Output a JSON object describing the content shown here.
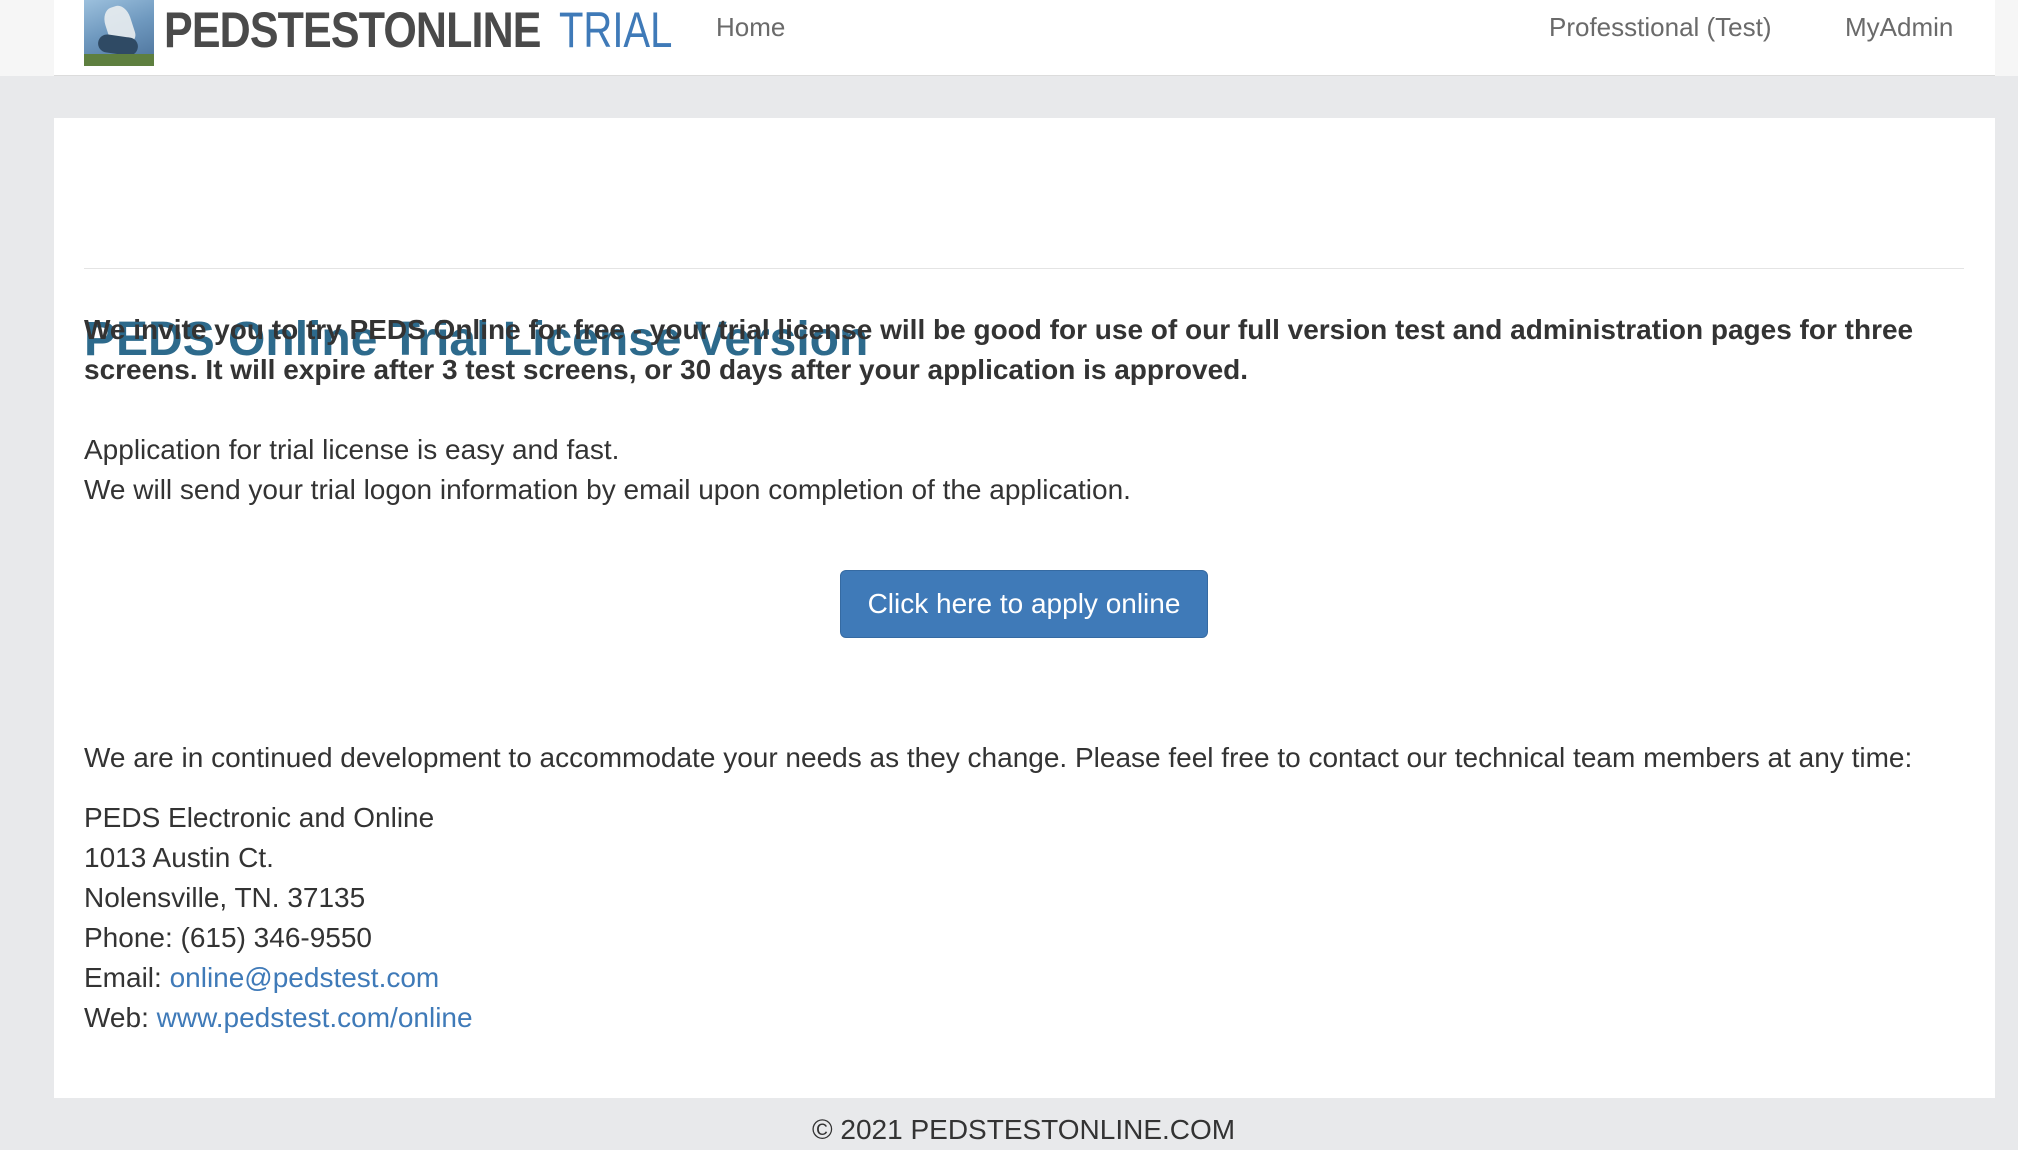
{
  "header": {
    "brand": "PEDSTESTONLINE",
    "brand_suffix": "TRIAL",
    "nav": {
      "home": "Home",
      "professional": "Professtional (Test)",
      "admin": "MyAdmin"
    }
  },
  "main": {
    "title": "PEDS Online Trial License Version",
    "intro": "We invite you to try PEDS Online for free - your trial license will be good for use of our full version test and administration pages for three screens. It will expire after 3 test screens, or 30 days after your application is approved.",
    "para1": "Application for trial license is easy and fast.",
    "para2": "We will send your trial logon information by email upon completion of the application.",
    "apply_button": "Click here to apply online",
    "contact_intro": "We are in continued development to accommodate your needs as they change. Please feel free to contact our technical team members at any time:",
    "contact": {
      "org": "PEDS Electronic and Online",
      "street": "1013 Austin Ct.",
      "city": "Nolensville, TN. 37135",
      "phone": "Phone: (615) 346-9550",
      "email_label": "Email: ",
      "email": "online@pedstest.com",
      "web_label": "Web: ",
      "web": "www.pedstest.com/online"
    }
  },
  "footer": {
    "copyright": "© 2021 PEDSTESTONLINE.COM"
  },
  "colors": {
    "accent": "#3f7ab8",
    "title": "#2d6a8c",
    "background": "#e8e9eb"
  }
}
